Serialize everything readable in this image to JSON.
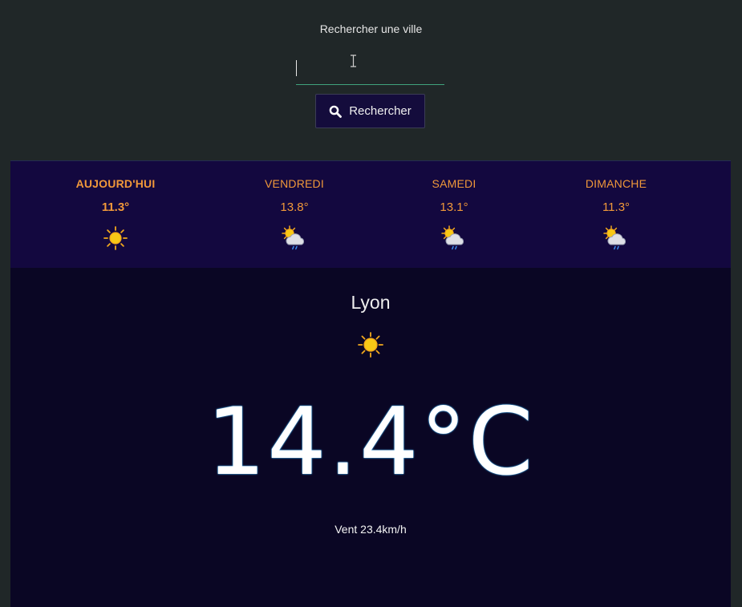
{
  "search": {
    "label": "Rechercher une ville",
    "value": "",
    "placeholder": "",
    "button_label": "Rechercher"
  },
  "forecast": [
    {
      "day": "AUJOURD'HUI",
      "temp": "11.3°",
      "icon": "sun-icon",
      "today": true
    },
    {
      "day": "VENDREDI",
      "temp": "13.8°",
      "icon": "sun-cloud-rain-icon",
      "today": false
    },
    {
      "day": "SAMEDI",
      "temp": "13.1°",
      "icon": "sun-cloud-rain-icon",
      "today": false
    },
    {
      "day": "DIMANCHE",
      "temp": "11.3°",
      "icon": "sun-cloud-rain-icon",
      "today": false
    }
  ],
  "current": {
    "city": "Lyon",
    "icon": "sun-icon",
    "temperature": "14.4°C",
    "wind": "Vent 23.4km/h"
  },
  "colors": {
    "page_bg": "#202728",
    "forecast_bg": "#13083f",
    "panel_bg": "#0a0624",
    "accent_orange": "#f0983a",
    "input_underline": "#3fa37d",
    "button_bg": "#140c3c"
  }
}
